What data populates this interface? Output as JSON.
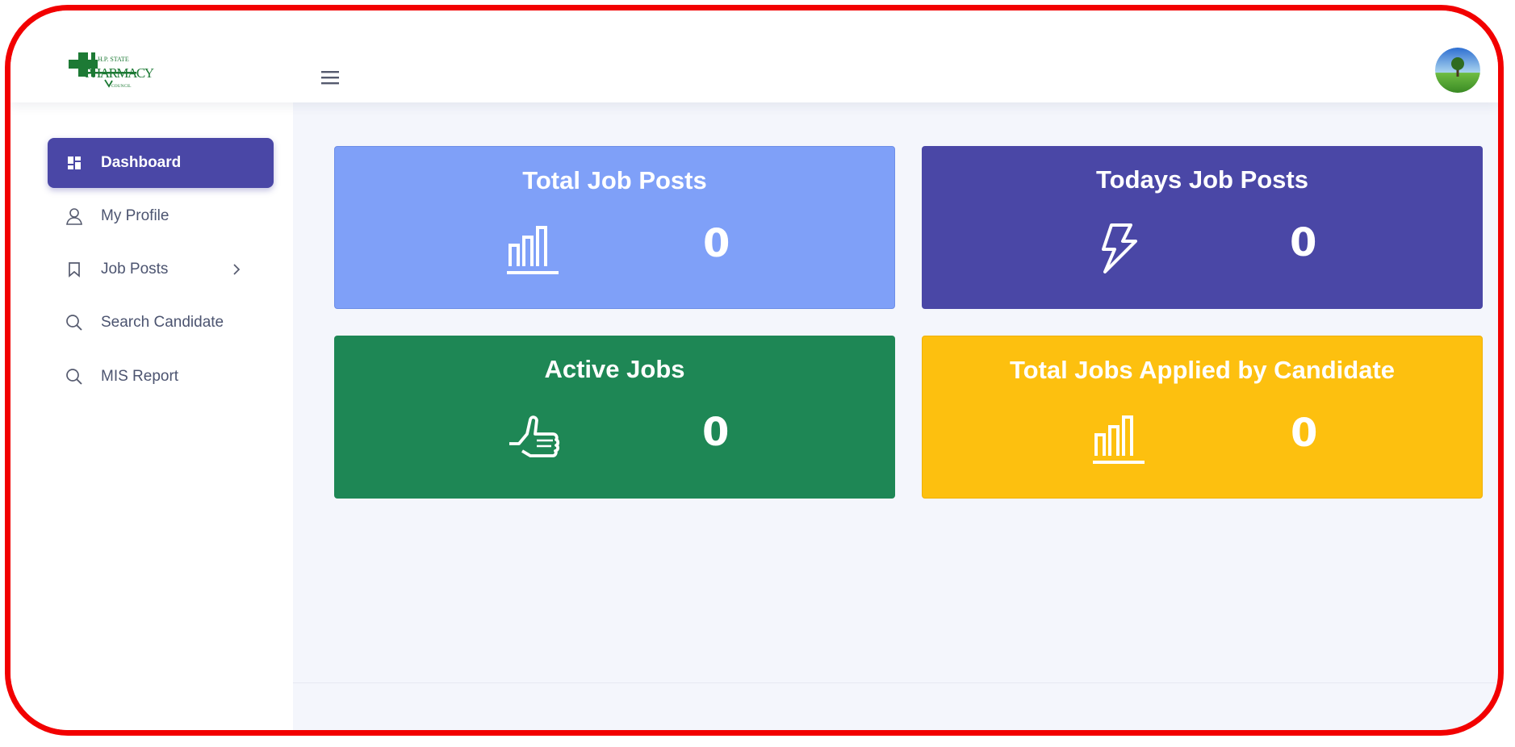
{
  "header": {
    "logo": {
      "line1": "H.P. STATE",
      "line2": "PHARMACY",
      "line3": "COUNCIL"
    },
    "menu_icon": "hamburger-icon",
    "avatar_icon": "user-avatar"
  },
  "sidebar": {
    "items": [
      {
        "label": "Dashboard",
        "icon": "dashboard-icon",
        "active": true
      },
      {
        "label": "My Profile",
        "icon": "user-icon"
      },
      {
        "label": "Job Posts",
        "icon": "bookmark-icon",
        "has_submenu": true
      },
      {
        "label": "Search Candidate",
        "icon": "search-icon"
      },
      {
        "label": "MIS Report",
        "icon": "search-icon"
      }
    ]
  },
  "cards": [
    {
      "title": "Total Job Posts",
      "value": "0",
      "icon": "bar-chart-icon",
      "color": "#7fa0f8"
    },
    {
      "title": "Todays Job Posts",
      "value": "0",
      "icon": "lightning-icon",
      "color": "#4a47a6"
    },
    {
      "title": "Active Jobs",
      "value": "0",
      "icon": "thumbs-up-icon",
      "color": "#1e8755"
    },
    {
      "title": "Total Jobs Applied by Candidate",
      "value": "0",
      "icon": "bar-chart-icon",
      "color": "#fdc00f"
    }
  ],
  "colors": {
    "frame_border": "#f20000",
    "accent": "#4a47a6",
    "background": "#f4f6fc"
  }
}
